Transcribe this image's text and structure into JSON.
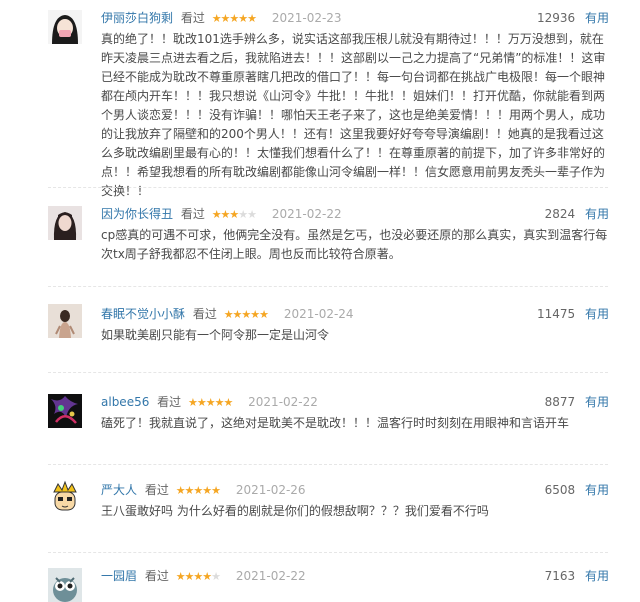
{
  "reviews": [
    {
      "user": "伊丽莎白狗剩",
      "watched": "看过",
      "rating": 5,
      "date": "2021-02-23",
      "votes": "12936",
      "useful": "有用",
      "text": "真的绝了！！耽改101选手辨么多，说实话这部我压根儿就没有期待过！！！万万没想到，就在昨天凌晨三点进去看之后，我就陷进去！！！这部剧以一己之力提高了“兄弟情”的标准！！这审已经不能成为耽改不尊重原著瞎几把改的借口了！！每一句台词都在挑战广电极限！每一个眼神都在颅内开车！！！我只想说《山河令》牛批！！牛批！！姐妹们！！打开优酷，你就能看到两个男人谈恋爱！！！没有诈骗！！哪怕天王老子来了，这也是绝美爱情！！！用两个男人，成功的让我放弃了隔壁和的200个男人！！还有！这里我要好好夸夸导演编剧！！她真的是我看过这么多耽改编剧里最有心的！！太懂我们想看什么了！！在尊重原著的前提下，加了许多非常好的点！！希望我想看的所有耽改编剧都能像山河令编剧一样！！信女愿意用前男友秃头一辈子作为交换！！"
    },
    {
      "user": "因为你长得丑",
      "watched": "看过",
      "rating": 3,
      "date": "2021-02-22",
      "votes": "2824",
      "useful": "有用",
      "text": "cp感真的可遇不可求，他俩完全没有。虽然是乞丐，也没必要还原的那么真实，真实到温客行每次tx周子舒我都忍不住闭上眼。周也反而比较符合原著。"
    },
    {
      "user": "春眠不觉小小酥",
      "watched": "看过",
      "rating": 5,
      "date": "2021-02-24",
      "votes": "11475",
      "useful": "有用",
      "text": "如果耽美剧只能有一个阿令那一定是山河令"
    },
    {
      "user": "albee56",
      "watched": "看过",
      "rating": 5,
      "date": "2021-02-22",
      "votes": "8877",
      "useful": "有用",
      "text": "磕死了！我就直说了，这绝对是耽美不是耽改！！！温客行时时刻刻在用眼神和言语开车"
    },
    {
      "user": "严大人",
      "watched": "看过",
      "rating": 5,
      "date": "2021-02-26",
      "votes": "6508",
      "useful": "有用",
      "text": "王八蛋敢好吗 为什么好看的剧就是你们的假想敌啊？？？我们爱看不行吗"
    },
    {
      "user": "一园眉",
      "watched": "看过",
      "rating": 4,
      "date": "2021-02-22",
      "votes": "7163",
      "useful": "有用",
      "text": ""
    }
  ]
}
